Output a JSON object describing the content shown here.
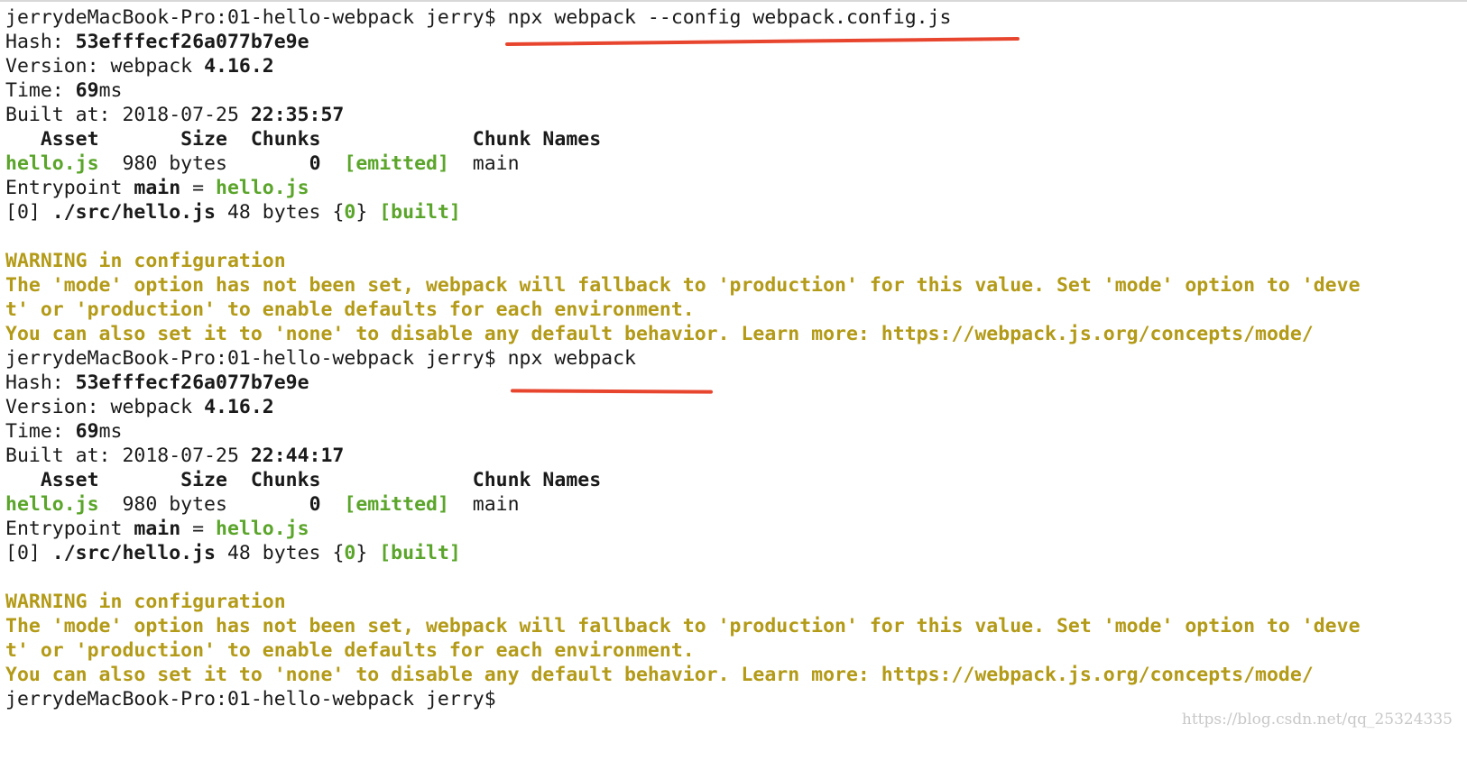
{
  "prompt": "jerrydeMacBook-Pro:01-hello-webpack jerry$",
  "watermark": "https://blog.csdn.net/qq_25324335",
  "runs": [
    {
      "command": " npx webpack --config webpack.config.js",
      "hash_label": "Hash: ",
      "hash": "53efffecf26a077b7e9e",
      "version_label": "Version: webpack ",
      "version": "4.16.2",
      "time_label": "Time: ",
      "time_value": "69",
      "time_unit": "ms",
      "built_label": "Built at: 2018-07-25 ",
      "built_time": "22:35:57",
      "table_header": "   Asset       Size  Chunks             Chunk Names",
      "asset": "hello.js",
      "asset_size": "  980 bytes       ",
      "chunk": "0",
      "emitted": "[emitted]",
      "chunk_name": "main",
      "entry_label": "Entrypoint ",
      "entry_main": "main",
      "entry_eq": " = ",
      "entry_file": "hello.js",
      "module_index": "[0] ",
      "module_path": "./src/hello.js",
      "module_size": " 48 bytes {",
      "module_chunk": "0",
      "module_close": "} ",
      "built_tag": "[built]",
      "warning_title": "WARNING in configuration",
      "warning_line1": "The 'mode' option has not been set, webpack will fallback to 'production' for this value. Set 'mode' option to 'deve",
      "warning_line2": "t' or 'production' to enable defaults for each environment.",
      "warning_line3": "You can also set it to 'none' to disable any default behavior. Learn more: https://webpack.js.org/concepts/mode/"
    },
    {
      "command": " npx webpack",
      "hash_label": "Hash: ",
      "hash": "53efffecf26a077b7e9e",
      "version_label": "Version: webpack ",
      "version": "4.16.2",
      "time_label": "Time: ",
      "time_value": "69",
      "time_unit": "ms",
      "built_label": "Built at: 2018-07-25 ",
      "built_time": "22:44:17",
      "table_header": "   Asset       Size  Chunks             Chunk Names",
      "asset": "hello.js",
      "asset_size": "  980 bytes       ",
      "chunk": "0",
      "emitted": "[emitted]",
      "chunk_name": "main",
      "entry_label": "Entrypoint ",
      "entry_main": "main",
      "entry_eq": " = ",
      "entry_file": "hello.js",
      "module_index": "[0] ",
      "module_path": "./src/hello.js",
      "module_size": " 48 bytes {",
      "module_chunk": "0",
      "module_close": "} ",
      "built_tag": "[built]",
      "warning_title": "WARNING in configuration",
      "warning_line1": "The 'mode' option has not been set, webpack will fallback to 'production' for this value. Set 'mode' option to 'deve",
      "warning_line2": "t' or 'production' to enable defaults for each environment.",
      "warning_line3": "You can also set it to 'none' to disable any default behavior. Learn more: https://webpack.js.org/concepts/mode/"
    }
  ],
  "annotation_color": "#e8452e",
  "success_color": "#5aa52a",
  "warning_color": "#b39a17"
}
